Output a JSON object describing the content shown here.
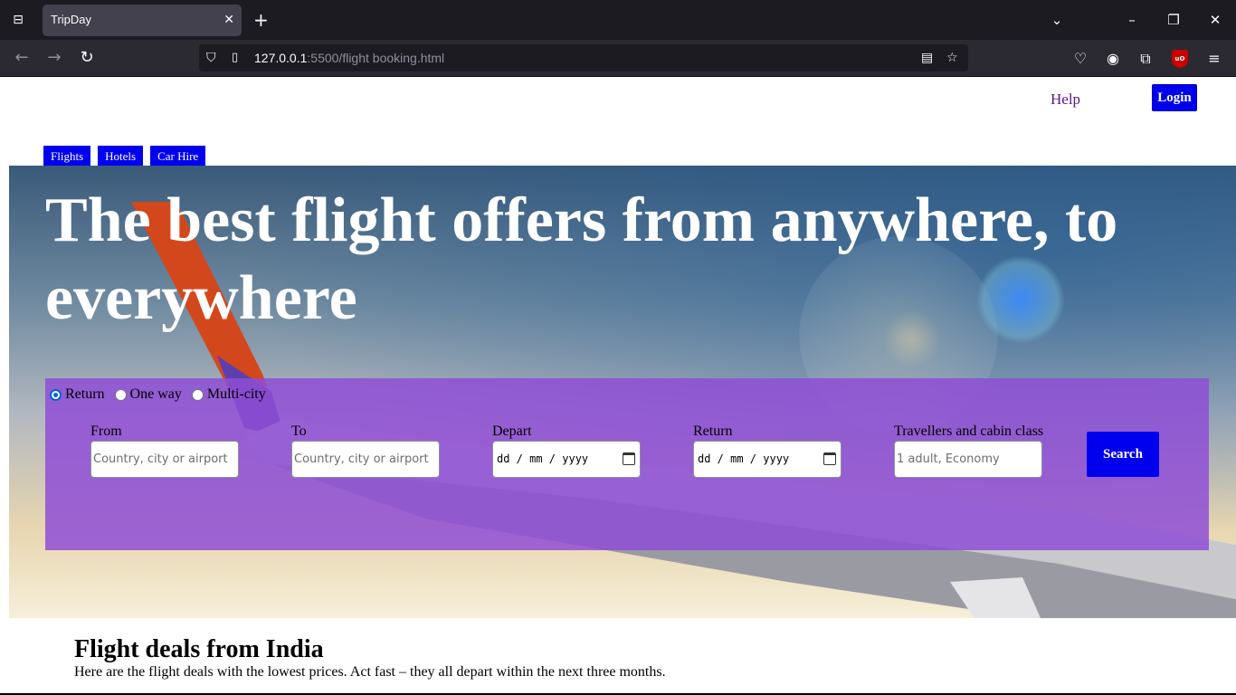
{
  "browser": {
    "tab_title": "TripDay",
    "new_tab_symbol": "+",
    "url_host": "127.0.0.1",
    "url_rest": ":5500/flight booking.html"
  },
  "header": {
    "help_label": "Help",
    "login_label": "Login"
  },
  "service_tabs": [
    {
      "label": "Flights"
    },
    {
      "label": "Hotels"
    },
    {
      "label": "Car Hire"
    }
  ],
  "hero": {
    "headline": "The best flight offers from anywhere, to everywhere"
  },
  "search": {
    "trip_types": [
      {
        "label": "Return",
        "checked": true
      },
      {
        "label": "One way",
        "checked": false
      },
      {
        "label": "Multi-city",
        "checked": false
      }
    ],
    "from": {
      "label": "From",
      "placeholder": "Country, city or airport"
    },
    "to": {
      "label": "To",
      "placeholder": "Country, city or airport"
    },
    "depart": {
      "label": "Depart",
      "value": "dd / mm / yyyy"
    },
    "return": {
      "label": "Return",
      "value": "dd / mm / yyyy"
    },
    "travellers": {
      "label": "Travellers and cabin class",
      "placeholder": "1 adult, Economy"
    },
    "search_label": "Search"
  },
  "deals": {
    "title": "Flight deals from India",
    "subtitle": "Here are the flight deals with the lowest prices. Act fast – they all depart within the next three months."
  },
  "colors": {
    "accent_blue": "#0000ee",
    "panel_purple": "#8f4ed6",
    "visited_link": "#551a8b"
  }
}
